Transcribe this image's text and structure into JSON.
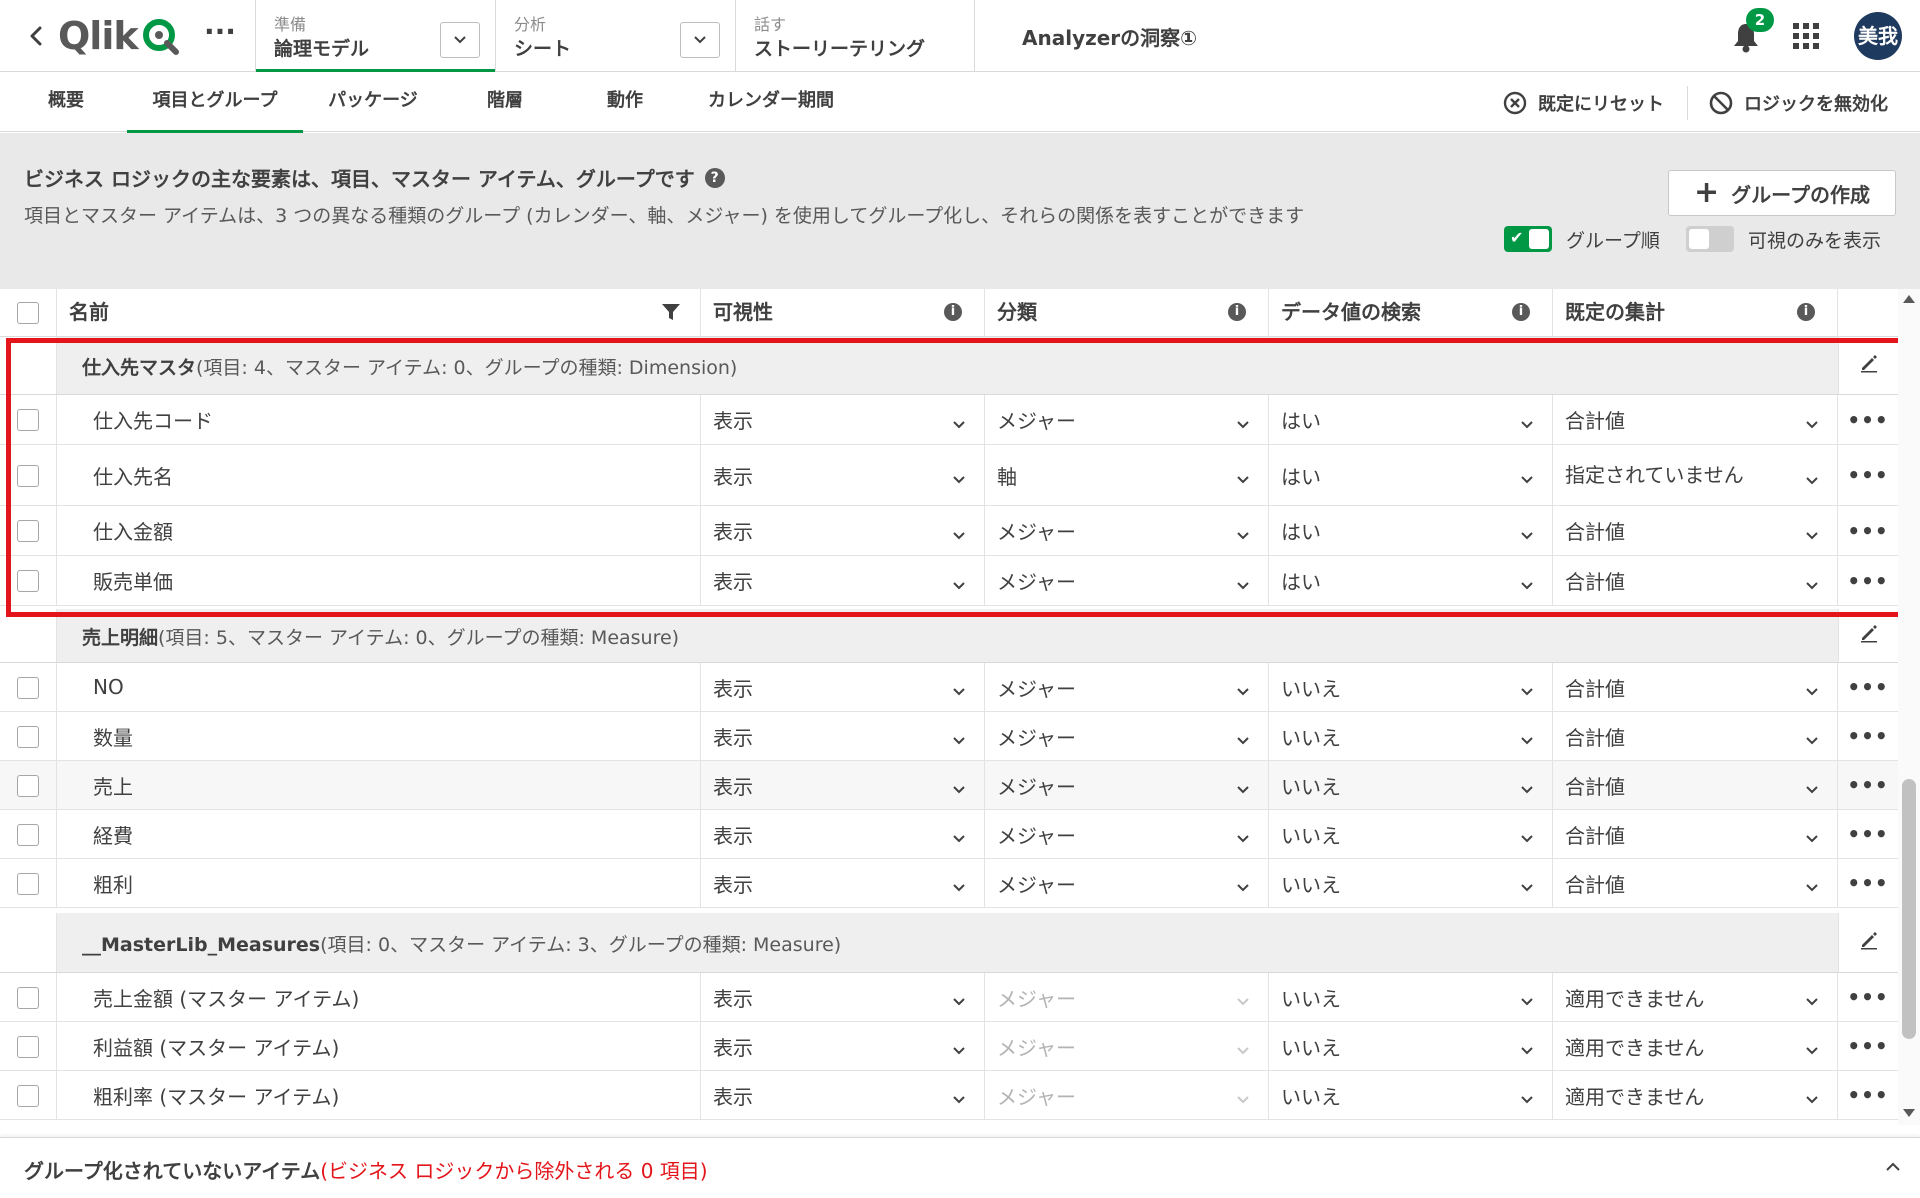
{
  "header": {
    "logo_text": "Qlik",
    "nav": [
      {
        "small": "準備",
        "big": "論理モデル"
      },
      {
        "small": "分析",
        "big": "シート"
      },
      {
        "small": "話す",
        "big": "ストーリーテリング"
      }
    ],
    "app_title": "Analyzerの洞察①",
    "notification_count": "2",
    "avatar": "美我",
    "accent_color": "#009845"
  },
  "tabs": {
    "items": [
      "概要",
      "項目とグループ",
      "パッケージ",
      "階層",
      "動作",
      "カレンダー期間"
    ],
    "reset_label": "既定にリセット",
    "disable_label": "ロジックを無効化"
  },
  "info": {
    "title": "ビジネス ロジックの主な要素は、項目、マスター アイテム、グループです",
    "help": "?",
    "description": "項目とマスター アイテムは、3 つの異なる種類のグループ (カレンダー、軸、メジャー) を使用してグループ化し、それらの関係を表すことができます",
    "create_button": "グループの作成",
    "toggle_group_order": "グループ順",
    "toggle_visible_only": "可視のみを表示"
  },
  "table": {
    "columns": [
      "名前",
      "可視性",
      "分類",
      "データ値の検索",
      "既定の集計"
    ],
    "info_glyph": "i",
    "more_glyph": "•••",
    "groups": [
      {
        "name": "仕入先マスタ",
        "detail": "(項目: 4、マスター アイテム: 0、グループの種類: Dimension)",
        "rows": [
          {
            "name": "仕入先コード",
            "visibility": "表示",
            "category": "メジャー",
            "search": "はい",
            "aggregation": "合計値"
          },
          {
            "name": "仕入先名",
            "visibility": "表示",
            "category": "軸",
            "search": "はい",
            "aggregation": "指定されていません"
          },
          {
            "name": "仕入金額",
            "visibility": "表示",
            "category": "メジャー",
            "search": "はい",
            "aggregation": "合計値"
          },
          {
            "name": "販売単価",
            "visibility": "表示",
            "category": "メジャー",
            "search": "はい",
            "aggregation": "合計値"
          }
        ]
      },
      {
        "name": "売上明細",
        "detail": "(項目: 5、マスター アイテム: 0、グループの種類: Measure)",
        "rows": [
          {
            "name": "NO",
            "visibility": "表示",
            "category": "メジャー",
            "search": "いいえ",
            "aggregation": "合計値"
          },
          {
            "name": "数量",
            "visibility": "表示",
            "category": "メジャー",
            "search": "いいえ",
            "aggregation": "合計値"
          },
          {
            "name": "売上",
            "visibility": "表示",
            "category": "メジャー",
            "search": "いいえ",
            "aggregation": "合計値"
          },
          {
            "name": "経費",
            "visibility": "表示",
            "category": "メジャー",
            "search": "いいえ",
            "aggregation": "合計値"
          },
          {
            "name": "粗利",
            "visibility": "表示",
            "category": "メジャー",
            "search": "いいえ",
            "aggregation": "合計値"
          }
        ]
      },
      {
        "name": "__MasterLib_Measures",
        "detail": "(項目: 0、マスター アイテム: 3、グループの種類: Measure)",
        "rows": [
          {
            "name": "売上金額 (マスター アイテム)",
            "visibility": "表示",
            "category": "メジャー",
            "search": "いいえ",
            "aggregation": "適用できません"
          },
          {
            "name": "利益額 (マスター アイテム)",
            "visibility": "表示",
            "category": "メジャー",
            "search": "いいえ",
            "aggregation": "適用できません"
          },
          {
            "name": "粗利率 (マスター アイテム)",
            "visibility": "表示",
            "category": "メジャー",
            "search": "いいえ",
            "aggregation": "適用できません"
          }
        ]
      }
    ]
  },
  "footer": {
    "label": "グループ化されていないアイテム",
    "detail": "(ビジネス ロジックから除外される 0 項目)",
    "alert_color": "#e3151a"
  }
}
